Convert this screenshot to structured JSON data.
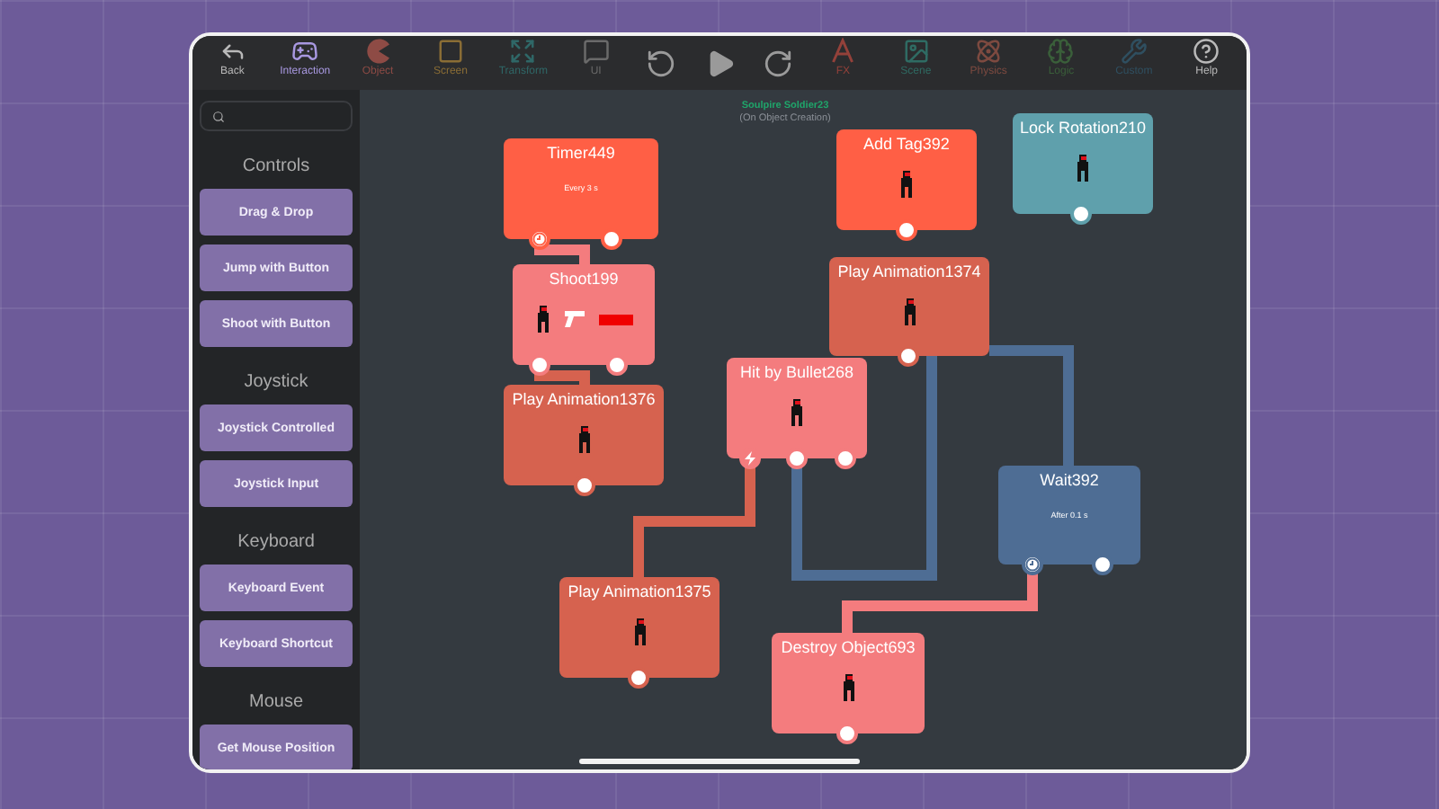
{
  "toolbar": [
    {
      "kind": "tool",
      "label": "Back",
      "color": "#b9b9b9"
    },
    {
      "kind": "tool",
      "label": "Interaction",
      "color": "#a898e0"
    },
    {
      "kind": "tool",
      "label": "Object",
      "color": "#8e4b45"
    },
    {
      "kind": "tool",
      "label": "Screen",
      "color": "#8a6d35"
    },
    {
      "kind": "tool",
      "label": "Transform",
      "color": "#2f6767"
    },
    {
      "kind": "tool",
      "label": "UI",
      "color": "#6a6a6a"
    },
    {
      "kind": "action"
    },
    {
      "kind": "action"
    },
    {
      "kind": "action"
    },
    {
      "kind": "tool",
      "label": "FX",
      "color": "#93413a"
    },
    {
      "kind": "tool",
      "label": "Scene",
      "color": "#2f6b63"
    },
    {
      "kind": "tool",
      "label": "Physics",
      "color": "#7d4a40"
    },
    {
      "kind": "tool",
      "label": "Logic",
      "color": "#3a5f3a"
    },
    {
      "kind": "tool",
      "label": "Custom",
      "color": "#2f4f60"
    },
    {
      "kind": "tool",
      "label": "Help",
      "color": "#b9b9b9"
    }
  ],
  "sidebar": {
    "sections": [
      {
        "title": "Controls",
        "items": [
          "Drag & Drop",
          "Jump with Button",
          "Shoot with Button"
        ]
      },
      {
        "title": "Joystick",
        "items": [
          "Joystick Controlled",
          "Joystick Input"
        ]
      },
      {
        "title": "Keyboard",
        "items": [
          "Keyboard Event",
          "Keyboard Shortcut"
        ]
      },
      {
        "title": "Mouse",
        "items": [
          "Get Mouse Position"
        ]
      }
    ]
  },
  "canvas": {
    "object_name": "Soulpire Soldier23",
    "event": "(On Object Creation)",
    "nodes": [
      {
        "title": "Timer449",
        "color": "#ff5f45",
        "subtitle": "Every 3 s",
        "ports": [
          {
            "kind": "clock"
          },
          {
            "kind": "plain"
          }
        ]
      },
      {
        "title": "Shoot199",
        "color": "#f47c7e",
        "content": [
          {
            "kind": "soldier"
          },
          {
            "kind": "gun"
          },
          {
            "kind": "bar"
          }
        ],
        "ports": [
          {
            "kind": "plain"
          },
          {
            "kind": "plain"
          }
        ]
      },
      {
        "title": "Play Animation1376",
        "color": "#d6624f",
        "content": [
          {
            "kind": "soldier"
          }
        ],
        "ports": [
          {
            "kind": "plain"
          }
        ]
      },
      {
        "title": "Add Tag392",
        "color": "#ff5f45",
        "content": [
          {
            "kind": "soldier"
          }
        ],
        "ports": [
          {
            "kind": "plain"
          }
        ]
      },
      {
        "title": "Lock Rotation210",
        "color": "#5fa0ac",
        "content": [
          {
            "kind": "soldier"
          }
        ],
        "ports": [
          {
            "kind": "plain"
          }
        ]
      },
      {
        "title": "Play Animation1374",
        "color": "#d6624f",
        "content": [
          {
            "kind": "soldier"
          }
        ],
        "ports": [
          {
            "kind": "plain"
          }
        ]
      },
      {
        "title": "Hit by Bullet268",
        "color": "#f47c7e",
        "content": [
          {
            "kind": "soldier"
          }
        ],
        "ports": [
          {
            "kind": "bolt"
          },
          {
            "kind": "plain"
          },
          {
            "kind": "plain"
          }
        ]
      },
      {
        "title": "Wait392",
        "color": "#4e6d94",
        "subtitle": "After 0.1 s",
        "ports": [
          {
            "kind": "clock"
          },
          {
            "kind": "plain"
          }
        ]
      },
      {
        "title": "Play Animation1375",
        "color": "#d6624f",
        "content": [
          {
            "kind": "soldier"
          }
        ],
        "ports": [
          {
            "kind": "plain"
          }
        ]
      },
      {
        "title": "Destroy Object693",
        "color": "#f47c7e",
        "content": [
          {
            "kind": "soldier"
          }
        ],
        "ports": [
          {
            "kind": "plain"
          }
        ]
      }
    ]
  }
}
